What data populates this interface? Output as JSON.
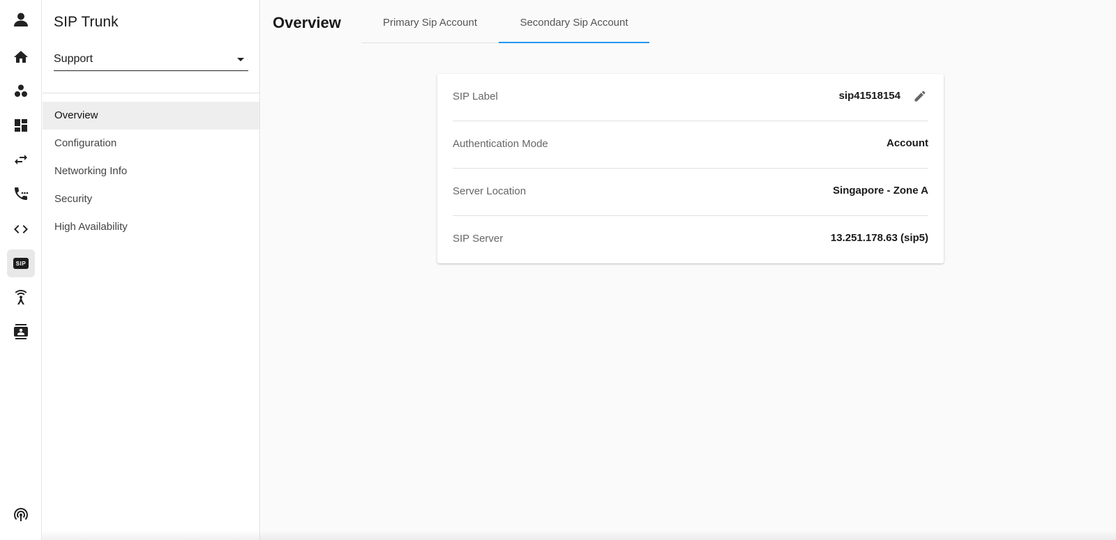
{
  "rail": {
    "items": [
      {
        "icon": "account-icon"
      },
      {
        "icon": "home-icon"
      },
      {
        "icon": "bubbles-icon"
      },
      {
        "icon": "dashboard-icon"
      },
      {
        "icon": "swap-icon"
      },
      {
        "icon": "phone-dialpad-icon"
      },
      {
        "icon": "code-icon"
      },
      {
        "icon": "sip-icon",
        "label": "SIP",
        "active": true
      },
      {
        "icon": "antenna-icon"
      },
      {
        "icon": "contacts-icon"
      }
    ],
    "bottom_icon": "broadcast-icon"
  },
  "sidebar": {
    "title": "SIP Trunk",
    "select": {
      "value": "Support"
    },
    "items": [
      {
        "label": "Overview",
        "active": true
      },
      {
        "label": "Configuration"
      },
      {
        "label": "Networking Info"
      },
      {
        "label": "Security"
      },
      {
        "label": "High Availability"
      }
    ]
  },
  "main": {
    "title": "Overview",
    "tabs": [
      {
        "label": "Primary Sip Account"
      },
      {
        "label": "Secondary Sip Account",
        "active": true
      }
    ],
    "accent_color": "#2196f3",
    "details": [
      {
        "label": "SIP Label",
        "value": "sip41518154",
        "editable": true
      },
      {
        "label": "Authentication Mode",
        "value": "Account"
      },
      {
        "label": "Server Location",
        "value": "Singapore - Zone A"
      },
      {
        "label": "SIP Server",
        "value": "13.251.178.63 (sip5)"
      }
    ]
  }
}
